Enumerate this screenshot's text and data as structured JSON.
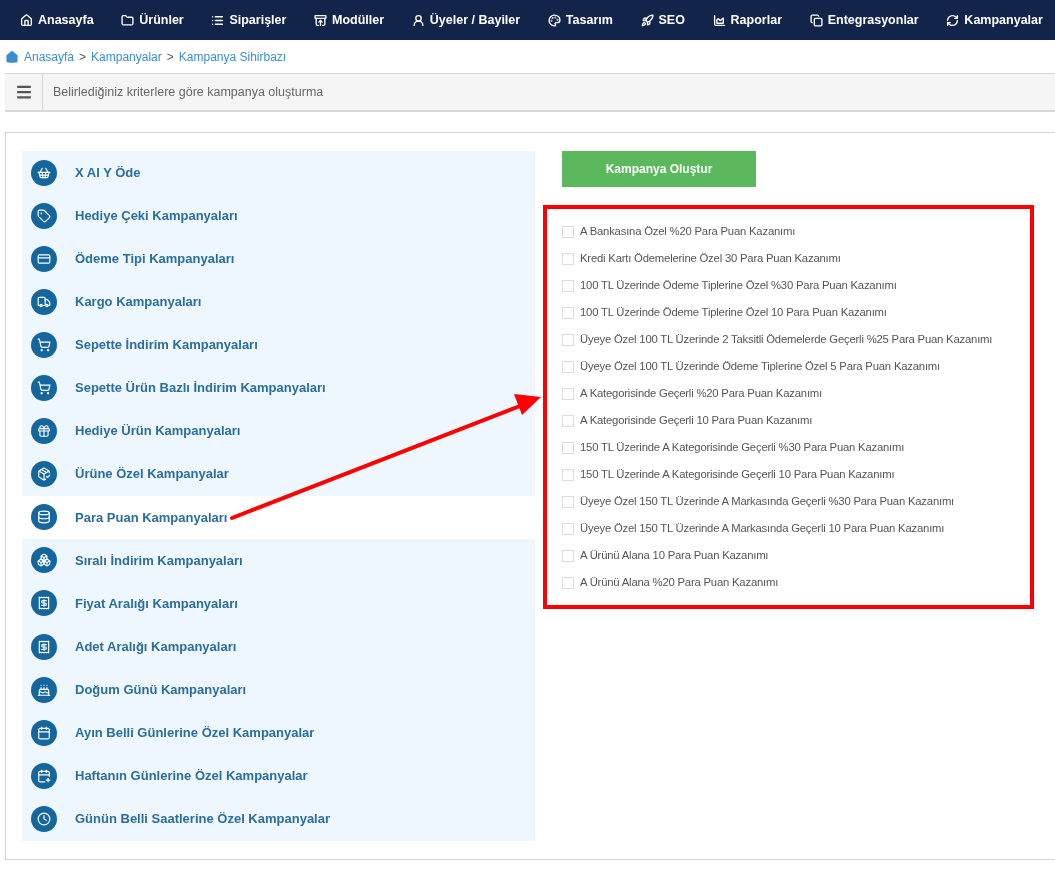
{
  "nav": [
    {
      "label": "Anasayfa"
    },
    {
      "label": "Ürünler"
    },
    {
      "label": "Siparişler"
    },
    {
      "label": "Modüller"
    },
    {
      "label": "Üyeler / Bayiler"
    },
    {
      "label": "Tasarım"
    },
    {
      "label": "SEO"
    },
    {
      "label": "Raporlar"
    },
    {
      "label": "Entegrasyonlar"
    },
    {
      "label": "Kampanyalar"
    }
  ],
  "breadcrumb": [
    "Anasayfa",
    "Kampanyalar",
    "Kampanya Sihirbazı"
  ],
  "breadcrumb_separator": ">",
  "header": {
    "title": "Belirlediğiniz kriterlere göre kampanya oluşturma"
  },
  "categories": [
    {
      "label": "X Al Y Öde",
      "selected": false
    },
    {
      "label": "Hediye Çeki Kampanyaları",
      "selected": false
    },
    {
      "label": "Ödeme Tipi Kampanyaları",
      "selected": false
    },
    {
      "label": "Kargo Kampanyaları",
      "selected": false
    },
    {
      "label": "Sepette İndirim Kampanyaları",
      "selected": false
    },
    {
      "label": "Sepette Ürün Bazlı İndirim Kampanyaları",
      "selected": false
    },
    {
      "label": "Hediye Ürün Kampanyaları",
      "selected": false
    },
    {
      "label": "Ürüne Özel Kampanyalar",
      "selected": false
    },
    {
      "label": "Para Puan Kampanyaları",
      "selected": true
    },
    {
      "label": "Sıralı İndirim Kampanyaları",
      "selected": false
    },
    {
      "label": "Fiyat Aralığı Kampanyaları",
      "selected": false
    },
    {
      "label": "Adet Aralığı Kampanyaları",
      "selected": false
    },
    {
      "label": "Doğum Günü Kampanyaları",
      "selected": false
    },
    {
      "label": "Ayın Belli Günlerine Özel Kampanyalar",
      "selected": false
    },
    {
      "label": "Haftanın Günlerine Özel Kampanyalar",
      "selected": false
    },
    {
      "label": "Günün Belli Saatlerine Özel Kampanyalar",
      "selected": false
    }
  ],
  "create_button": "Kampanya Oluştur",
  "options": [
    {
      "label": "A Bankasına Özel %20 Para Puan Kazanımı",
      "checked": false
    },
    {
      "label": "Kredi Kartı Ödemelerine Özel 30 Para Puan Kazanımı",
      "checked": false
    },
    {
      "label": "100 TL Üzerinde Ödeme Tiplerine Özel %30 Para Puan Kazanımı",
      "checked": false
    },
    {
      "label": "100 TL Üzerinde Ödeme Tiplerine Özel 10 Para Puan Kazanımı",
      "checked": false
    },
    {
      "label": "Üyeye Özel 100 TL Üzerinde 2 Taksitli Ödemelerde Geçerli %25 Para Puan Kazanımı",
      "checked": false
    },
    {
      "label": "Üyeye Özel 100 TL Üzerinde Ödeme Tiplerine Özel 5 Para Puan Kazanımı",
      "checked": false
    },
    {
      "label": "A Kategorisinde Geçerli %20 Para Puan Kazanımı",
      "checked": false
    },
    {
      "label": "A Kategorisinde Geçerli 10 Para Puan Kazanımı",
      "checked": false
    },
    {
      "label": "150 TL Üzerinde A Kategorisinde Geçerli %30 Para Puan Kazanımı",
      "checked": false
    },
    {
      "label": "150 TL Üzerinde A Kategorisinde Geçerli 10 Para Puan Kazanımı",
      "checked": false
    },
    {
      "label": "Üyeye Özel 150 TL Üzerinde A Markasında Geçerli %30 Para Puan Kazanımı",
      "checked": false
    },
    {
      "label": "Üyeye Özel 150 TL Üzerinde A Markasında Geçerli 10 Para Puan Kazanımı",
      "checked": false
    },
    {
      "label": "A Ürünü Alana 10 Para Puan Kazanımı",
      "checked": false
    },
    {
      "label": "A Ürünü Alana %20 Para Puan Kazanımı",
      "checked": false
    }
  ]
}
